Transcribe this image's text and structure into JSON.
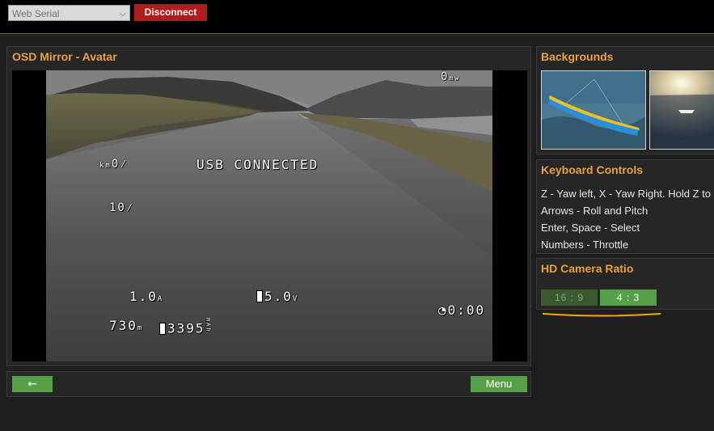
{
  "topbar": {
    "port_value": "Web Serial",
    "disconnect_label": "Disconnect"
  },
  "osd": {
    "title": "OSD Mirror - Avatar",
    "overlay": {
      "top_right": "ᴳ₀",
      "top_right_suffix": "0",
      "top_right_unit": "mw",
      "left_unit1": "km",
      "left1": "0⁄",
      "status": "USB CONNECTED",
      "left2": "10⁄",
      "current": "1.0",
      "current_unit": "A",
      "voltage": "5.0",
      "voltage_unit": "V",
      "timer": "0:00",
      "altitude": "730",
      "altitude_unit": "m",
      "capacity": "3395",
      "capacity_unit": "mAh"
    }
  },
  "bottom": {
    "back_label": "←",
    "menu_label": "Menu"
  },
  "backgrounds": {
    "title": "Backgrounds"
  },
  "keyboard": {
    "title": "Keyboard Controls",
    "lines": [
      "Z - Yaw left, X - Yaw Right. Hold Z to",
      "Arrows - Roll and Pitch",
      "Enter, Space - Select",
      "Numbers - Throttle"
    ]
  },
  "hd_camera": {
    "title": "HD Camera Ratio",
    "options": [
      "16 : 9",
      "4 : 3"
    ],
    "selected": "4 : 3"
  },
  "colors": {
    "accent": "#e8a040",
    "button_green": "#56a04a",
    "disconnect_red": "#b21c1c"
  }
}
